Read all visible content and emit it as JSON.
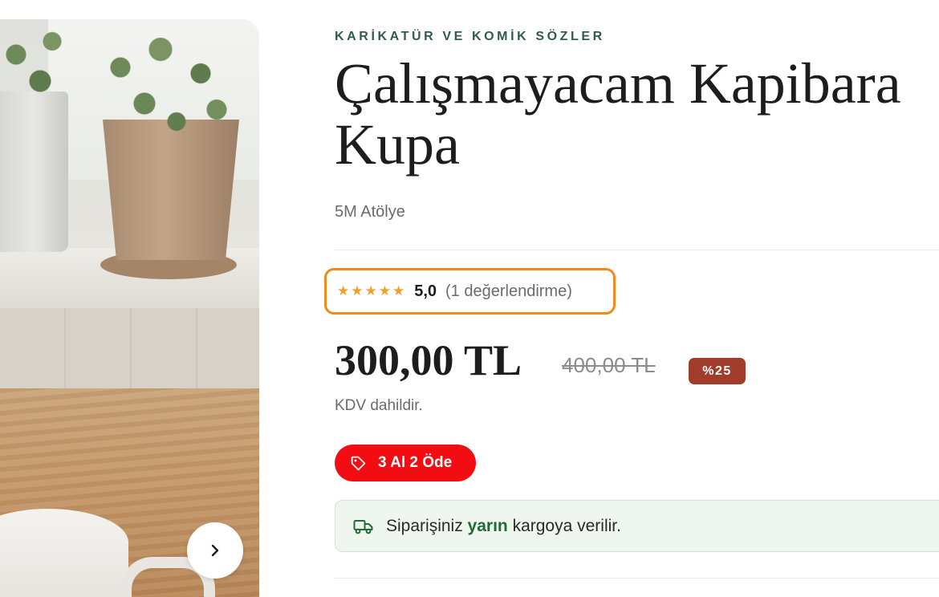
{
  "gallery": {
    "next_label": "›"
  },
  "product": {
    "category": "KARİKATÜR VE KOMİK SÖZLER",
    "title_line1": "Çalışmayacam Kapibara",
    "title_line2": "Kupa",
    "brand": "5M Atölye",
    "rating": {
      "stars": "★★★★★",
      "score": "5,0",
      "reviews": "(1 değerlendirme)"
    },
    "price": "300,00 TL",
    "old_price": "400,00 TL",
    "discount": "%25",
    "vat_note": "KDV dahildir.",
    "campaign_label": "3 Al 2 Öde",
    "shipping": {
      "prefix": "Siparişiniz ",
      "highlight": "yarın",
      "suffix": " kargoya verilir."
    }
  },
  "colors": {
    "category": "#2f5d45",
    "rating_highlight_border": "#f08a1c",
    "stars": "#f0a02a",
    "discount_bg": "#a13c2a",
    "campaign_bg": "#f20d12",
    "shipping_bg": "#eef6ef",
    "shipping_highlight": "#1f6b34"
  },
  "icons": {
    "next": "chevron-right-icon",
    "campaign": "tag-icon",
    "shipping": "truck-icon"
  }
}
